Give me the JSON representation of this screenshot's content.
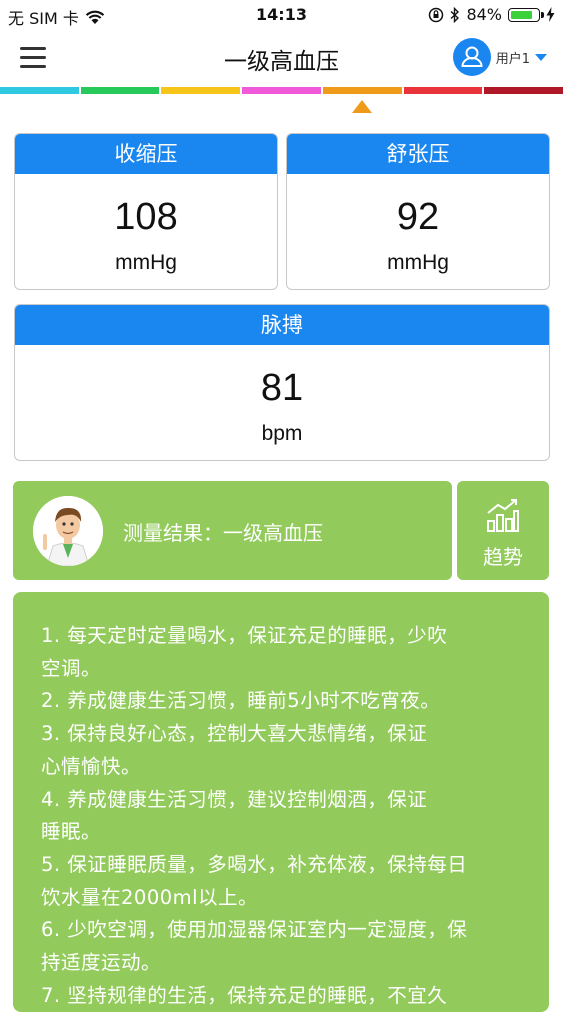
{
  "status_bar": {
    "carrier": "无 SIM 卡",
    "time": "14:13",
    "battery_percent": "84%",
    "battery_level": 0.84
  },
  "nav": {
    "title": "一级高血压",
    "user_label": "用户1"
  },
  "level_bar": {
    "colors": [
      "#2ec8e0",
      "#26c95a",
      "#f5c518",
      "#f05ad8",
      "#f09a1a",
      "#e9343b",
      "#b0182a"
    ],
    "pointer_color": "#f09a1a"
  },
  "cards": {
    "systolic": {
      "label": "收缩压",
      "value": "108",
      "unit": "mmHg"
    },
    "diastolic": {
      "label": "舒张压",
      "value": "92",
      "unit": "mmHg"
    },
    "pulse": {
      "label": "脉搏",
      "value": "81",
      "unit": "bpm"
    }
  },
  "result": {
    "text": "测量结果：一级高血压",
    "trend_label": "趋势"
  },
  "advice": [
    "1. 每天定时定量喝水，保证充足的睡眠，少吹",
    "空调。",
    "2. 养成健康生活习惯，睡前5小时不吃宵夜。",
    "3. 保持良好心态，控制大喜大悲情绪，保证",
    "心情愉快。",
    "4. 养成健康生活习惯，建议控制烟酒，保证",
    "睡眠。",
    "5. 保证睡眠质量，多喝水，补充体液，保持每日",
    "饮水量在2000ml以上。",
    "6. 少吹空调，使用加湿器保证室内一定湿度，保",
    "持适度运动。",
    "7. 坚持规律的生活，保持充足的睡眠，不宜久"
  ],
  "colors": {
    "primary_blue": "#1a86f0",
    "result_green": "#92cb5c"
  }
}
